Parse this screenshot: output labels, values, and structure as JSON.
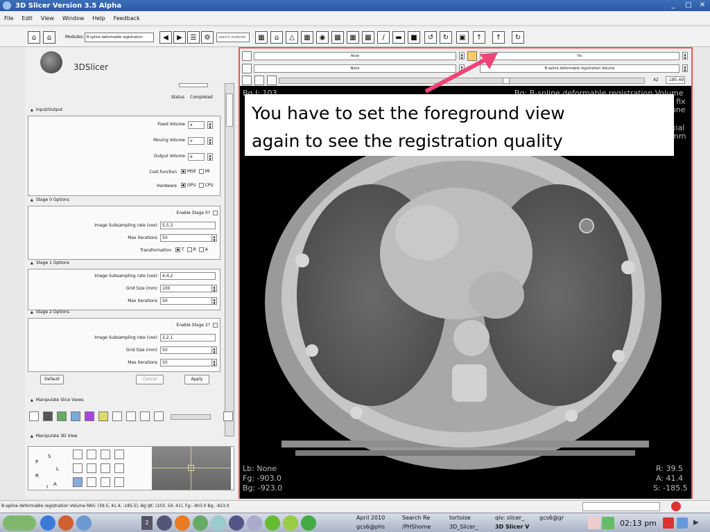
{
  "window": {
    "title": "3D Slicer Version 3.5 Alpha"
  },
  "menu": [
    "File",
    "Edit",
    "View",
    "Window",
    "Help",
    "Feedback"
  ],
  "toolbar": {
    "modules_label": "Modules:",
    "module_selected": "B-spline deformable registration",
    "search_placeholder": "search modules"
  },
  "logo": {
    "text": "3DSlicer"
  },
  "module": {
    "status_label": "Status",
    "status_value": "Completed",
    "io": {
      "header": "Input/Output",
      "fixed_label": "Fixed Volume",
      "fixed_value": "x",
      "moving_label": "Moving Volume",
      "moving_value": "v",
      "output_label": "Output Volume",
      "output_value": "e",
      "cost_label": "Cost function",
      "cost_opt1": "MSE",
      "cost_opt2": "MI",
      "hw_label": "Hardware",
      "hw_opt1": "GPU",
      "hw_opt2": "CPU"
    },
    "stage0": {
      "header": "Stage 0 Options",
      "enable_label": "Enable Stage 0?",
      "subsample_label": "Image Subsampling rate (vox)",
      "subsample_value": "5,5,3",
      "iter_label": "Max iterations",
      "iter_value": "50",
      "transform_label": "Transformation",
      "t1": "T",
      "t2": "R",
      "t3": "A"
    },
    "stage1": {
      "header": "Stage 1 Options",
      "subsample_label": "Image Subsampling rate (vox)",
      "subsample_value": "4,4,2",
      "grid_label": "Grid Size (mm)",
      "grid_value": "100",
      "iter_label": "Max iterations",
      "iter_value": "50"
    },
    "stage2": {
      "header": "Stage 2 Options",
      "enable_label": "Enable Stage 2?",
      "subsample_label": "Image Subsampling rate (vox)",
      "subsample_value": "2,2,1",
      "grid_label": "Grid Size (mm)",
      "grid_value": "50",
      "iter_label": "Max iterations",
      "iter_value": "50"
    },
    "buttons": {
      "default": "Default",
      "cancel": "Cancel",
      "apply": "Apply"
    }
  },
  "manip_slice": {
    "header": "Manipulate Slice Views"
  },
  "manip_3d": {
    "header": "Manipulate 3D View"
  },
  "slice_controls": {
    "orientation": "Axial",
    "label_layer": "None",
    "foreground": "fix",
    "background": "B-spline deformable registration Volume",
    "slice_index": "42",
    "offset": "-185.49"
  },
  "overlays": {
    "top_left": "Bg I: 103",
    "top_right_1": "Bg: B-spline deformable registration Volume",
    "top_right_2": ": fix",
    "top_right_3": "one",
    "top_right_4": "xial",
    "top_right_5": "mm",
    "bottom_left_1": "Lb: None",
    "bottom_left_2": "Fg: -903.0",
    "bottom_left_3": "Bg: -923.0",
    "bottom_right_1": "R: 39.5",
    "bottom_right_2": "A: 41.4",
    "bottom_right_3": "S: -185.5"
  },
  "callout": {
    "line1": "You have to set the foreground view",
    "line2": "again to see the registration quality"
  },
  "statusbar": {
    "text": "B-spline deformable registration Volume RAS: (39.5, 41.4, -185.5), Bg IJK: (103, 54, 41), Fg: -903.0 Bg: -923.0"
  },
  "taskbar": {
    "desktop_count": "2",
    "task1a": "April 2010",
    "task1b": "gcs6@phs",
    "task2a": "Search Re",
    "task2b": "/PHShome",
    "task3a": "tortoise",
    "task3b": "3D_Slicer_",
    "task4a": "qiv: slicer_",
    "task4b": "3D Slicer V",
    "task5a": "gcs6@gr",
    "clock": "02:13 pm"
  },
  "colors": {
    "accent": "#2c5aa0",
    "view_border": "#e55555",
    "arrow": "#ee4477"
  }
}
